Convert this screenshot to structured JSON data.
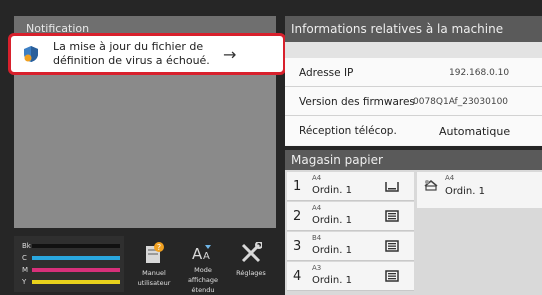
{
  "notification": {
    "title": "Notification",
    "message": "La mise à jour du fichier de définition de virus a échoué.",
    "arrow": "→",
    "highlight_color": "#d8202c"
  },
  "toner": [
    {
      "label": "Bk",
      "color": "#111111"
    },
    {
      "label": "C",
      "color": "#2aa8e0"
    },
    {
      "label": "M",
      "color": "#d8307a"
    },
    {
      "label": "Y",
      "color": "#e8d21c"
    }
  ],
  "toolbar": {
    "manual_label": "Manuel utilisateur",
    "display_label": "Mode affichage étendu",
    "settings_label": "Réglages"
  },
  "machine_info": {
    "title": "Informations relatives à la machine",
    "rows": [
      {
        "label": "Adresse IP",
        "value": "192.168.0.10"
      },
      {
        "label": "Version des firmwares",
        "value": "0078Q1Af_23030100"
      },
      {
        "label": "Réception télécop.",
        "value": "Automatique"
      }
    ]
  },
  "paper": {
    "title": "Magasin papier",
    "trays": [
      {
        "num": "1",
        "size": "A4",
        "type": "Ordin. 1",
        "icon": "tray-empty-icon"
      },
      {
        "num": "2",
        "size": "A4",
        "type": "Ordin. 1",
        "icon": "tray-full-icon"
      },
      {
        "num": "3",
        "size": "B4",
        "type": "Ordin. 1",
        "icon": "tray-full-icon"
      },
      {
        "num": "4",
        "size": "A3",
        "type": "Ordin. 1",
        "icon": "tray-full-icon"
      }
    ],
    "bypass": {
      "size": "A4",
      "type": "Ordin. 1",
      "icon": "bypass-tray-icon"
    }
  }
}
